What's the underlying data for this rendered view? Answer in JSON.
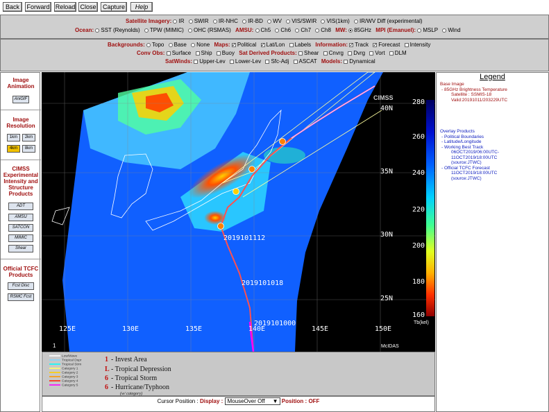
{
  "toolbar": {
    "back": "Back",
    "forward": "Forward",
    "reload": "Reload",
    "close": "Close",
    "capture": "Capture",
    "help": "Help"
  },
  "imagery": {
    "label": "Satellite Imagery:",
    "options": [
      "IR",
      "SWIR",
      "IR-NHC",
      "IR-BD",
      "WV",
      "VIS/SWIR",
      "VIS(1km)",
      "IR/WV Diff (experimental)"
    ],
    "ocean_label": "Ocean:",
    "ocean_options": [
      "SST (Reynolds)",
      "TPW (MIMIC)",
      "OHC (RSMAS)"
    ],
    "amsu_label": "AMSU:",
    "amsu_options": [
      "Ch5",
      "Ch6",
      "Ch7",
      "Ch8"
    ],
    "mw_label": "MW:",
    "mw_options": [
      "85GHz"
    ],
    "mpi_label": "MPI (Emanuel):",
    "mpi_options": [
      "MSLP",
      "Wind"
    ],
    "selected": "85GHz"
  },
  "overlays": {
    "backgrounds_label": "Backgrounds:",
    "backgrounds": [
      "Topo",
      "Base",
      "None"
    ],
    "maps_label": "Maps:",
    "maps": [
      "Political",
      "Lat/Lon",
      "Labels"
    ],
    "information_label": "Information:",
    "information": [
      "Track",
      "Forecast",
      "Intensity"
    ],
    "convobs_label": "Conv Obs:",
    "convobs": [
      "Surface",
      "Ship",
      "Buoy"
    ],
    "satderived_label": "Sat Derived Products:",
    "satderived": [
      "Shear",
      "Cnvrg",
      "Dvrg",
      "Vort",
      "DLM"
    ],
    "satwinds_label": "SatWinds:",
    "satwinds": [
      "Upper-Lev",
      "Lower-Lev",
      "Sfc-Adj",
      "ASCAT"
    ],
    "models_label": "Models:",
    "models": [
      "Dynamical"
    ]
  },
  "left": {
    "animation_title": "Image Animation",
    "anigif": "AniGIF",
    "resolution_title": "Image Resolution",
    "res": [
      "1km",
      "2km",
      "4km",
      "8km"
    ],
    "res_selected": "4km",
    "cimss_title": "CIMSS Experimental Intensity and Structure Products",
    "cimss_buttons": [
      "ADT",
      "AMSU",
      "SATCON",
      "MIMIC",
      "Shear"
    ],
    "tcfc_title": "Official TCFC Products",
    "tcfc_buttons": [
      "Fcst Disc",
      "RSMC Fcst"
    ]
  },
  "map": {
    "lon_labels": [
      "125E",
      "130E",
      "135E",
      "140E",
      "145E",
      "150E"
    ],
    "lat_labels": [
      "40N",
      "35N",
      "30N",
      "25N"
    ],
    "track_labels": [
      "2019101112",
      "2019101018",
      "2019101000"
    ],
    "frame_number": "1",
    "credit": "McIDAS",
    "logo": "CIMSS",
    "colorbar_ticks": [
      "280",
      "260",
      "240",
      "220",
      "200",
      "180",
      "160"
    ],
    "colorbar_unit": "Tb(kel)"
  },
  "legend": {
    "title": "Legend",
    "base_heading": "Base Image",
    "base_lines": [
      "- 85GHz Brightness Temperature",
      "Satellite : SSMIS-18",
      "Valid:20191011/203229UTC"
    ],
    "overlay_heading": "Overlay Products",
    "overlay_lines": [
      "- Political Boundaries",
      "- Latitude/Longitude",
      "- Working Best Track",
      "06OCT2019/06:00UTC-",
      "11OCT2019/18:00UTC",
      "(source:JTWC)",
      "- Official TCFC Forecast",
      "11OCT2019/18:00UTC",
      "(source:JTWC)"
    ]
  },
  "track_legend": {
    "lines": [
      "Low/Wave",
      "Tropical Dspr",
      "Tropical Strm",
      "Category 1",
      "Category 2",
      "Category 3",
      "Category 4",
      "Category 5"
    ],
    "line_colors": [
      "#ffffff",
      "#7fd8ff",
      "#00ffff",
      "#ffff66",
      "#ffd000",
      "#ff9900",
      "#ff2200",
      "#ff00ff"
    ],
    "symbols": [
      "- Invest Area",
      "- Tropical Depression",
      "- Tropical Storm",
      "- Hurricane/Typhoon"
    ],
    "symbol_glyphs": [
      "1",
      "L",
      "6",
      "6"
    ],
    "category_note": "(w/ category)"
  },
  "cursor": {
    "position_label": "Cursor Position :",
    "display_label": "Display :",
    "display_value": "MouseOver Off",
    "position2_label": "Position :",
    "position_value": "OFF"
  }
}
